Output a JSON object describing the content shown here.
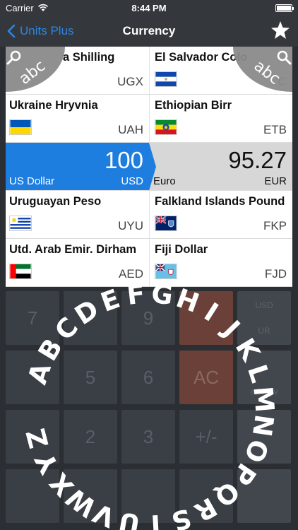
{
  "status": {
    "carrier": "Carrier",
    "time": "8:44 PM"
  },
  "nav": {
    "back_label": "Units Plus",
    "title": "Currency"
  },
  "abc_label": "abc",
  "rows": [
    {
      "left": {
        "name": "a Shilling",
        "code": "UGX"
      },
      "right": {
        "name": "El Salvador Colo",
        "code": "C"
      }
    },
    {
      "left": {
        "name": "Ukraine Hryvnia",
        "code": "UAH"
      },
      "right": {
        "name": "Ethiopian Birr",
        "code": "ETB"
      }
    }
  ],
  "active": {
    "left": {
      "value": "100",
      "name": "US Dollar",
      "code": "USD"
    },
    "right": {
      "value": "95.27",
      "name": "Euro",
      "code": "EUR"
    }
  },
  "rows2": [
    {
      "left": {
        "name": "Uruguayan Peso",
        "code": "UYU"
      },
      "right": {
        "name": "Falkland Islands Pound",
        "code": "FKP"
      }
    },
    {
      "left": {
        "name": "Utd. Arab Emir. Dirham",
        "code": "AED"
      },
      "right": {
        "name": "Fiji Dollar",
        "code": "FJD"
      }
    }
  ],
  "keypad": {
    "k7": "7",
    "k9": "9",
    "k5": "5",
    "k6": "6",
    "k2": "2",
    "k3": "3",
    "ac": "AC",
    "pm": "+/-",
    "usd_side": "USD",
    "ur_side": "UR",
    "add_fav": "add fav"
  },
  "wheel_letters": [
    "A",
    "B",
    "C",
    "D",
    "E",
    "F",
    "G",
    "H",
    "I",
    "J",
    "K",
    "L",
    "M",
    "N",
    "O",
    "P",
    "Q",
    "R",
    "S",
    "T",
    "U",
    "V",
    "W",
    "X",
    "Y",
    "Z"
  ],
  "colors": {
    "accent": "#1e7ee0",
    "nav_bg": "#34373c",
    "link": "#2e86e0"
  }
}
